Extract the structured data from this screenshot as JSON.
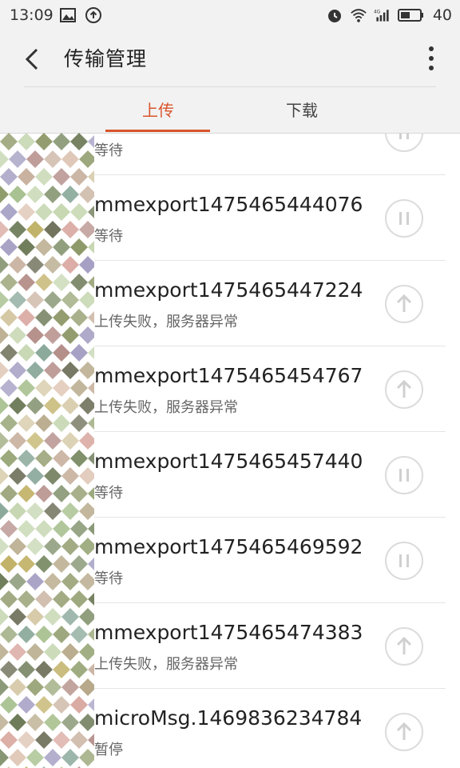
{
  "status_bar": {
    "time": "13:09",
    "battery_level": "40"
  },
  "header": {
    "title": "传输管理"
  },
  "tabs": [
    {
      "label": "上传",
      "active": true
    },
    {
      "label": "下载",
      "active": false
    }
  ],
  "colors": {
    "accent": "#d9542b",
    "background": "#f2f2f2",
    "divider": "#e4e4e4"
  },
  "transfers": [
    {
      "name": "",
      "status": "等待",
      "action": "pause-icon"
    },
    {
      "name": "mmexport1475465444076",
      "status": "等待",
      "action": "pause-icon"
    },
    {
      "name": "mmexport1475465447224",
      "status": "上传失败，服务器异常",
      "action": "upload-icon"
    },
    {
      "name": "mmexport1475465454767",
      "status": "上传失败，服务器异常",
      "action": "upload-icon"
    },
    {
      "name": "mmexport1475465457440",
      "status": "等待",
      "action": "pause-icon"
    },
    {
      "name": "mmexport1475465469592",
      "status": "等待",
      "action": "pause-icon"
    },
    {
      "name": "mmexport1475465474383",
      "status": "上传失败，服务器异常",
      "action": "upload-icon"
    },
    {
      "name": "microMsg.1469836234784",
      "status": "暂停",
      "action": "upload-icon"
    }
  ]
}
